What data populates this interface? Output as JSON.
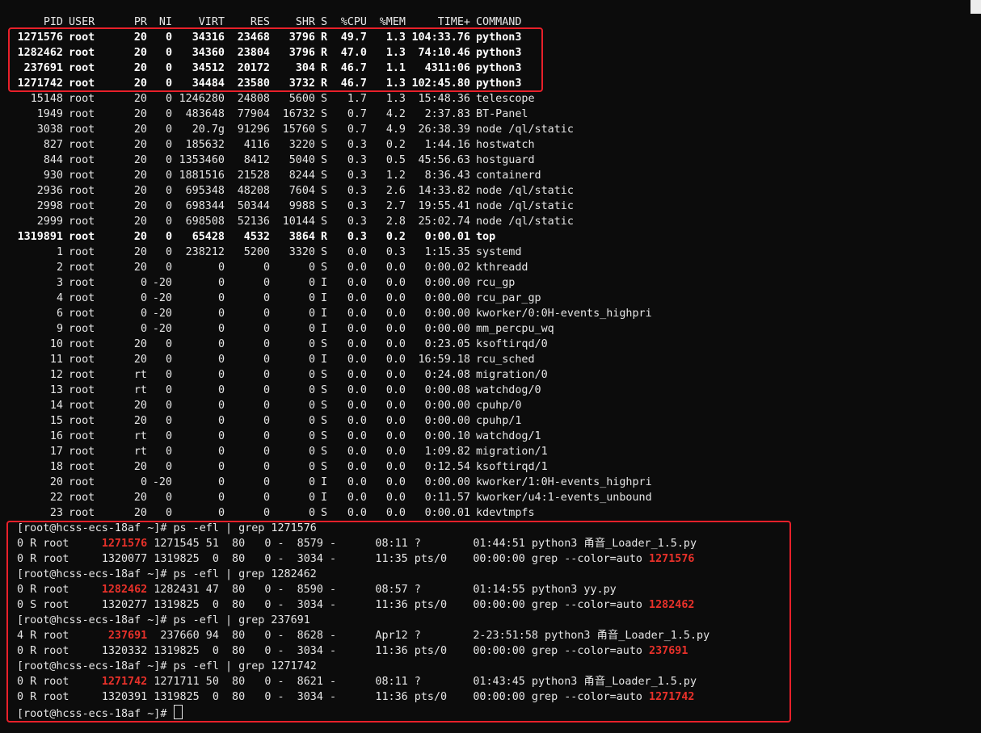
{
  "header": {
    "pid": "PID",
    "user": "USER",
    "pr": "PR",
    "ni": "NI",
    "virt": "VIRT",
    "res": "RES",
    "shr": "SHR",
    "s": "S",
    "cpu": "%CPU",
    "mem": "%MEM",
    "time": "TIME+",
    "command": "COMMAND"
  },
  "processes": [
    {
      "pid": "1271576",
      "user": "root",
      "pr": "20",
      "ni": "0",
      "virt": "34316",
      "res": "23468",
      "shr": "3796",
      "s": "R",
      "cpu": "49.7",
      "mem": "1.3",
      "time": "104:33.76",
      "command": "python3",
      "bold": true
    },
    {
      "pid": "1282462",
      "user": "root",
      "pr": "20",
      "ni": "0",
      "virt": "34360",
      "res": "23804",
      "shr": "3796",
      "s": "R",
      "cpu": "47.0",
      "mem": "1.3",
      "time": "74:10.46",
      "command": "python3",
      "bold": true
    },
    {
      "pid": "237691",
      "user": "root",
      "pr": "20",
      "ni": "0",
      "virt": "34512",
      "res": "20172",
      "shr": "304",
      "s": "R",
      "cpu": "46.7",
      "mem": "1.1",
      "time": "4311:06",
      "command": "python3",
      "bold": true
    },
    {
      "pid": "1271742",
      "user": "root",
      "pr": "20",
      "ni": "0",
      "virt": "34484",
      "res": "23580",
      "shr": "3732",
      "s": "R",
      "cpu": "46.7",
      "mem": "1.3",
      "time": "102:45.80",
      "command": "python3",
      "bold": true
    },
    {
      "pid": "15148",
      "user": "root",
      "pr": "20",
      "ni": "0",
      "virt": "1246280",
      "res": "24808",
      "shr": "5600",
      "s": "S",
      "cpu": "1.7",
      "mem": "1.3",
      "time": "15:48.36",
      "command": "telescope",
      "bold": false
    },
    {
      "pid": "1949",
      "user": "root",
      "pr": "20",
      "ni": "0",
      "virt": "483648",
      "res": "77904",
      "shr": "16732",
      "s": "S",
      "cpu": "0.7",
      "mem": "4.2",
      "time": "2:37.83",
      "command": "BT-Panel",
      "bold": false
    },
    {
      "pid": "3038",
      "user": "root",
      "pr": "20",
      "ni": "0",
      "virt": "20.7g",
      "res": "91296",
      "shr": "15760",
      "s": "S",
      "cpu": "0.7",
      "mem": "4.9",
      "time": "26:38.39",
      "command": "node /ql/static",
      "bold": false
    },
    {
      "pid": "827",
      "user": "root",
      "pr": "20",
      "ni": "0",
      "virt": "185632",
      "res": "4116",
      "shr": "3220",
      "s": "S",
      "cpu": "0.3",
      "mem": "0.2",
      "time": "1:44.16",
      "command": "hostwatch",
      "bold": false
    },
    {
      "pid": "844",
      "user": "root",
      "pr": "20",
      "ni": "0",
      "virt": "1353460",
      "res": "8412",
      "shr": "5040",
      "s": "S",
      "cpu": "0.3",
      "mem": "0.5",
      "time": "45:56.63",
      "command": "hostguard",
      "bold": false
    },
    {
      "pid": "930",
      "user": "root",
      "pr": "20",
      "ni": "0",
      "virt": "1881516",
      "res": "21528",
      "shr": "8244",
      "s": "S",
      "cpu": "0.3",
      "mem": "1.2",
      "time": "8:36.43",
      "command": "containerd",
      "bold": false
    },
    {
      "pid": "2936",
      "user": "root",
      "pr": "20",
      "ni": "0",
      "virt": "695348",
      "res": "48208",
      "shr": "7604",
      "s": "S",
      "cpu": "0.3",
      "mem": "2.6",
      "time": "14:33.82",
      "command": "node /ql/static",
      "bold": false
    },
    {
      "pid": "2998",
      "user": "root",
      "pr": "20",
      "ni": "0",
      "virt": "698344",
      "res": "50344",
      "shr": "9988",
      "s": "S",
      "cpu": "0.3",
      "mem": "2.7",
      "time": "19:55.41",
      "command": "node /ql/static",
      "bold": false
    },
    {
      "pid": "2999",
      "user": "root",
      "pr": "20",
      "ni": "0",
      "virt": "698508",
      "res": "52136",
      "shr": "10144",
      "s": "S",
      "cpu": "0.3",
      "mem": "2.8",
      "time": "25:02.74",
      "command": "node /ql/static",
      "bold": false
    },
    {
      "pid": "1319891",
      "user": "root",
      "pr": "20",
      "ni": "0",
      "virt": "65428",
      "res": "4532",
      "shr": "3864",
      "s": "R",
      "cpu": "0.3",
      "mem": "0.2",
      "time": "0:00.01",
      "command": "top",
      "bold": true
    },
    {
      "pid": "1",
      "user": "root",
      "pr": "20",
      "ni": "0",
      "virt": "238212",
      "res": "5200",
      "shr": "3320",
      "s": "S",
      "cpu": "0.0",
      "mem": "0.3",
      "time": "1:15.35",
      "command": "systemd",
      "bold": false
    },
    {
      "pid": "2",
      "user": "root",
      "pr": "20",
      "ni": "0",
      "virt": "0",
      "res": "0",
      "shr": "0",
      "s": "S",
      "cpu": "0.0",
      "mem": "0.0",
      "time": "0:00.02",
      "command": "kthreadd",
      "bold": false
    },
    {
      "pid": "3",
      "user": "root",
      "pr": "0",
      "ni": "-20",
      "virt": "0",
      "res": "0",
      "shr": "0",
      "s": "I",
      "cpu": "0.0",
      "mem": "0.0",
      "time": "0:00.00",
      "command": "rcu_gp",
      "bold": false
    },
    {
      "pid": "4",
      "user": "root",
      "pr": "0",
      "ni": "-20",
      "virt": "0",
      "res": "0",
      "shr": "0",
      "s": "I",
      "cpu": "0.0",
      "mem": "0.0",
      "time": "0:00.00",
      "command": "rcu_par_gp",
      "bold": false
    },
    {
      "pid": "6",
      "user": "root",
      "pr": "0",
      "ni": "-20",
      "virt": "0",
      "res": "0",
      "shr": "0",
      "s": "I",
      "cpu": "0.0",
      "mem": "0.0",
      "time": "0:00.00",
      "command": "kworker/0:0H-events_highpri",
      "bold": false
    },
    {
      "pid": "9",
      "user": "root",
      "pr": "0",
      "ni": "-20",
      "virt": "0",
      "res": "0",
      "shr": "0",
      "s": "I",
      "cpu": "0.0",
      "mem": "0.0",
      "time": "0:00.00",
      "command": "mm_percpu_wq",
      "bold": false
    },
    {
      "pid": "10",
      "user": "root",
      "pr": "20",
      "ni": "0",
      "virt": "0",
      "res": "0",
      "shr": "0",
      "s": "S",
      "cpu": "0.0",
      "mem": "0.0",
      "time": "0:23.05",
      "command": "ksoftirqd/0",
      "bold": false
    },
    {
      "pid": "11",
      "user": "root",
      "pr": "20",
      "ni": "0",
      "virt": "0",
      "res": "0",
      "shr": "0",
      "s": "I",
      "cpu": "0.0",
      "mem": "0.0",
      "time": "16:59.18",
      "command": "rcu_sched",
      "bold": false
    },
    {
      "pid": "12",
      "user": "root",
      "pr": "rt",
      "ni": "0",
      "virt": "0",
      "res": "0",
      "shr": "0",
      "s": "S",
      "cpu": "0.0",
      "mem": "0.0",
      "time": "0:24.08",
      "command": "migration/0",
      "bold": false
    },
    {
      "pid": "13",
      "user": "root",
      "pr": "rt",
      "ni": "0",
      "virt": "0",
      "res": "0",
      "shr": "0",
      "s": "S",
      "cpu": "0.0",
      "mem": "0.0",
      "time": "0:00.08",
      "command": "watchdog/0",
      "bold": false
    },
    {
      "pid": "14",
      "user": "root",
      "pr": "20",
      "ni": "0",
      "virt": "0",
      "res": "0",
      "shr": "0",
      "s": "S",
      "cpu": "0.0",
      "mem": "0.0",
      "time": "0:00.00",
      "command": "cpuhp/0",
      "bold": false
    },
    {
      "pid": "15",
      "user": "root",
      "pr": "20",
      "ni": "0",
      "virt": "0",
      "res": "0",
      "shr": "0",
      "s": "S",
      "cpu": "0.0",
      "mem": "0.0",
      "time": "0:00.00",
      "command": "cpuhp/1",
      "bold": false
    },
    {
      "pid": "16",
      "user": "root",
      "pr": "rt",
      "ni": "0",
      "virt": "0",
      "res": "0",
      "shr": "0",
      "s": "S",
      "cpu": "0.0",
      "mem": "0.0",
      "time": "0:00.10",
      "command": "watchdog/1",
      "bold": false
    },
    {
      "pid": "17",
      "user": "root",
      "pr": "rt",
      "ni": "0",
      "virt": "0",
      "res": "0",
      "shr": "0",
      "s": "S",
      "cpu": "0.0",
      "mem": "0.0",
      "time": "1:09.82",
      "command": "migration/1",
      "bold": false
    },
    {
      "pid": "18",
      "user": "root",
      "pr": "20",
      "ni": "0",
      "virt": "0",
      "res": "0",
      "shr": "0",
      "s": "S",
      "cpu": "0.0",
      "mem": "0.0",
      "time": "0:12.54",
      "command": "ksoftirqd/1",
      "bold": false
    },
    {
      "pid": "20",
      "user": "root",
      "pr": "0",
      "ni": "-20",
      "virt": "0",
      "res": "0",
      "shr": "0",
      "s": "I",
      "cpu": "0.0",
      "mem": "0.0",
      "time": "0:00.00",
      "command": "kworker/1:0H-events_highpri",
      "bold": false
    },
    {
      "pid": "22",
      "user": "root",
      "pr": "20",
      "ni": "0",
      "virt": "0",
      "res": "0",
      "shr": "0",
      "s": "I",
      "cpu": "0.0",
      "mem": "0.0",
      "time": "0:11.57",
      "command": "kworker/u4:1-events_unbound",
      "bold": false
    },
    {
      "pid": "23",
      "user": "root",
      "pr": "20",
      "ni": "0",
      "virt": "0",
      "res": "0",
      "shr": "0",
      "s": "S",
      "cpu": "0.0",
      "mem": "0.0",
      "time": "0:00.01",
      "command": "kdevtmpfs",
      "bold": false
    }
  ],
  "shell": [
    {
      "type": "prompt",
      "prompt": "[root@hcss-ecs-18af ~]# ",
      "command": "ps -efl | grep 1271576"
    },
    {
      "type": "ps",
      "fs": "0 R root",
      "pid": "1271576",
      "rest": " 1271545 51  80   0 -  8579 -      08:11 ?        01:44:51 python3 甬音_Loader_1.5.py",
      "hl": "pid"
    },
    {
      "type": "ps",
      "fs": "0 R root",
      "pid": "1320077",
      "rest": " 1319825  0  80   0 -  3034 -      11:35 pts/0    00:00:00 grep --color=auto ",
      "tail": "1271576",
      "hl": "tail"
    },
    {
      "type": "prompt",
      "prompt": "[root@hcss-ecs-18af ~]# ",
      "command": "ps -efl | grep 1282462"
    },
    {
      "type": "ps",
      "fs": "0 R root",
      "pid": "1282462",
      "rest": " 1282431 47  80   0 -  8590 -      08:57 ?        01:14:55 python3 yy.py",
      "hl": "pid"
    },
    {
      "type": "ps",
      "fs": "0 S root",
      "pid": "1320277",
      "rest": " 1319825  0  80   0 -  3034 -      11:36 pts/0    00:00:00 grep --color=auto ",
      "tail": "1282462",
      "hl": "tail"
    },
    {
      "type": "prompt",
      "prompt": "[root@hcss-ecs-18af ~]# ",
      "command": "ps -efl | grep 237691"
    },
    {
      "type": "ps",
      "fs": "4 R root",
      "pid": " 237691",
      "rest": "  237660 94  80   0 -  8628 -      Apr12 ?        2-23:51:58 python3 甬音_Loader_1.5.py",
      "hl": "pid"
    },
    {
      "type": "ps",
      "fs": "0 R root",
      "pid": "1320332",
      "rest": " 1319825  0  80   0 -  3034 -      11:36 pts/0    00:00:00 grep --color=auto ",
      "tail": "237691",
      "hl": "tail"
    },
    {
      "type": "prompt",
      "prompt": "[root@hcss-ecs-18af ~]# ",
      "command": "ps -efl | grep 1271742"
    },
    {
      "type": "ps",
      "fs": "0 R root",
      "pid": "1271742",
      "rest": " 1271711 50  80   0 -  8621 -      08:11 ?        01:43:45 python3 甬音_Loader_1.5.py",
      "hl": "pid"
    },
    {
      "type": "ps",
      "fs": "0 R root",
      "pid": "1320391",
      "rest": " 1319825  0  80   0 -  3034 -      11:36 pts/0    00:00:00 grep --color=auto ",
      "tail": "1271742",
      "hl": "tail"
    },
    {
      "type": "current",
      "prompt": "[root@hcss-ecs-18af ~]# ",
      "command": ""
    }
  ],
  "colors": {
    "background": "#0c0c0c",
    "text": "#e6e6e6",
    "highlight": "#e8312a",
    "annotation_box": "#e8202a"
  }
}
